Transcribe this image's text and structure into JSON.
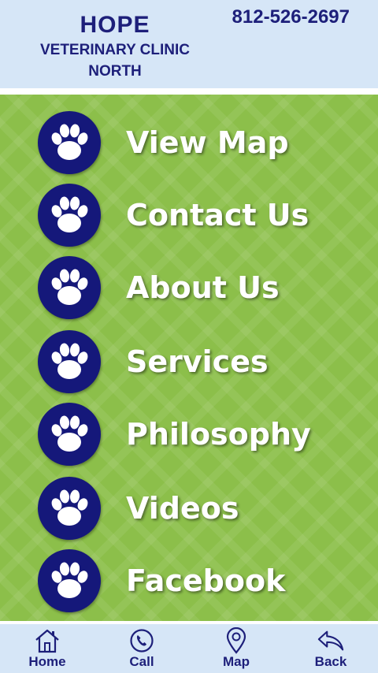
{
  "header": {
    "clinic_line1": "HOPE",
    "clinic_line2": "VETERINARY CLINIC",
    "clinic_line3": "NORTH",
    "phone": "812-526-2697"
  },
  "menu": {
    "items": [
      {
        "label": "View Map",
        "icon": "paw-icon"
      },
      {
        "label": "Contact Us",
        "icon": "paw-icon"
      },
      {
        "label": "About Us",
        "icon": "paw-icon"
      },
      {
        "label": "Services",
        "icon": "paw-icon"
      },
      {
        "label": "Philosophy",
        "icon": "paw-icon"
      },
      {
        "label": "Videos",
        "icon": "paw-icon"
      },
      {
        "label": "Facebook",
        "icon": "paw-icon"
      }
    ]
  },
  "footer": {
    "items": [
      {
        "label": "Home",
        "icon": "home-icon"
      },
      {
        "label": "Call",
        "icon": "phone-icon"
      },
      {
        "label": "Map",
        "icon": "map-pin-icon"
      },
      {
        "label": "Back",
        "icon": "back-arrow-icon"
      }
    ]
  },
  "colors": {
    "header_bg": "#d6e6f7",
    "main_bg": "#8cbf4a",
    "paw_circle": "#15187a",
    "text_navy": "#1d1f7a"
  }
}
